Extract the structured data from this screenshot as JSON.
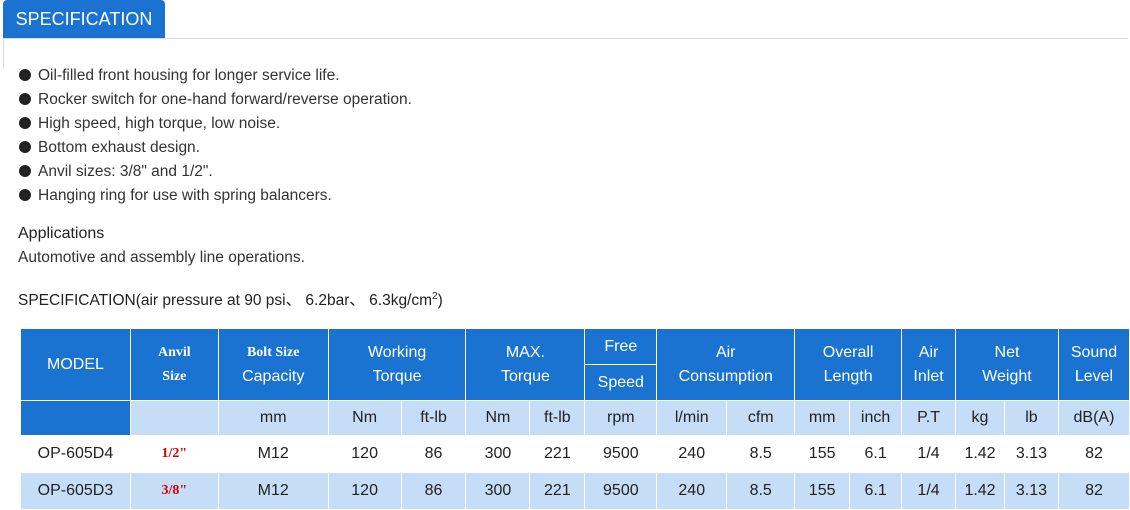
{
  "tab": {
    "label": "SPECIFICATION"
  },
  "features": [
    "Oil-filled front housing for longer service life.",
    "Rocker switch for one-hand forward/reverse operation.",
    "High speed, high torque, low noise.",
    "Bottom exhaust design.",
    "Anvil sizes: 3/8\" and 1/2\".",
    "Hanging ring for use with spring balancers."
  ],
  "applications": {
    "heading": "Applications",
    "text": "Automotive and assembly line operations."
  },
  "spec_heading": {
    "text": "SPECIFICATION(air pressure at 90 psi、 6.2bar、 6.3kg/cm",
    "sup": "2",
    "tail": ")"
  },
  "table": {
    "headers": {
      "model": "MODEL",
      "anvil_line1": "Anvil",
      "anvil_line2": "Size",
      "bolt_line1": "Bolt Size",
      "bolt_line2": "Capacity",
      "working_line1": "Working",
      "working_line2": "Torque",
      "max_line1": "MAX.",
      "max_line2": "Torque",
      "free_line1": "Free",
      "free_line2": "Speed",
      "air_line1": "Air",
      "air_line2": "Consumption",
      "overall_line1": "Overall",
      "overall_line2": "Length",
      "inlet_line1": "Air",
      "inlet_line2": "Inlet",
      "net_line1": "Net",
      "net_line2": "Weight",
      "sound_line1": "Sound",
      "sound_line2": "Level"
    },
    "units": [
      "",
      "mm",
      "Nm",
      "ft-lb",
      "Nm",
      "ft-lb",
      "rpm",
      "l/min",
      "cfm",
      "mm",
      "inch",
      "P.T",
      "kg",
      "lb",
      "dB(A)"
    ],
    "rows": [
      {
        "model": "OP-605D4",
        "anvil": "1/2\"",
        "bolt": "M12",
        "wt_nm": "120",
        "wt_ftlb": "86",
        "max_nm": "300",
        "max_ftlb": "221",
        "speed": "9500",
        "air_lmin": "240",
        "air_cfm": "8.5",
        "len_mm": "155",
        "len_inch": "6.1",
        "inlet": "1/4",
        "kg": "1.42",
        "lb": "3.13",
        "db": "82"
      },
      {
        "model": "OP-605D3",
        "anvil": "3/8\"",
        "bolt": "M12",
        "wt_nm": "120",
        "wt_ftlb": "86",
        "max_nm": "300",
        "max_ftlb": "221",
        "speed": "9500",
        "air_lmin": "240",
        "air_cfm": "8.5",
        "len_mm": "155",
        "len_inch": "6.1",
        "inlet": "1/4",
        "kg": "1.42",
        "lb": "3.13",
        "db": "82"
      }
    ]
  }
}
